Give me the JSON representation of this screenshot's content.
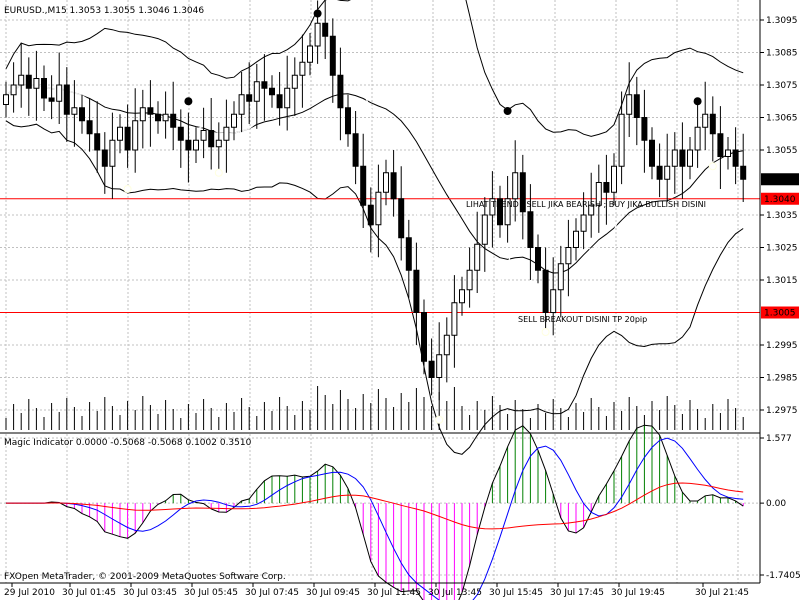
{
  "main_header": "EURUSD.,M15  1.3053 1.3055 1.3046 1.3046",
  "indicator_header": "Magic Indicator 0.0000 -0.5068 -0.5068 0.1002 0.3510",
  "copyright": "FXOpen MetaTrader, © 2001-2009 MetaQuotes Software Corp.",
  "annotations": [
    {
      "text": "LIHAT TREND : SELL JIKA BEARISH ; BUY JIKA BULLISH DISINI",
      "price": 1.3038
    },
    {
      "text": "SELL BREAKOUT DISINI TP 20pip",
      "price": 1.3003
    }
  ],
  "current_price_label": "1.3046",
  "colors": {
    "grid": "#c0c0c0",
    "bull_candle": "#ffffff",
    "bear_candle": "#000000",
    "hline": "#ff0000",
    "price_tag_bg": "#ff0000",
    "current_tag_bg": "#000000",
    "indicator_blue": "#0000ff",
    "indicator_red": "#ff0000",
    "hist_positive": "#008000",
    "hist_negative": "#ff00ff",
    "moving_average": "#ffffff"
  },
  "chart_data": [
    {
      "type": "candlestick",
      "symbol": "EURUSD.",
      "timeframe": "M15",
      "y_ticks": [
        "1.3095",
        "1.3085",
        "1.3075",
        "1.3065",
        "1.3055",
        "1.3035",
        "1.3025",
        "1.3015",
        "1.2995",
        "1.2985",
        "1.2975"
      ],
      "ylim": [
        1.2971,
        1.3102
      ],
      "horizontal_lines": [
        {
          "value": 1.304,
          "label": "1.3040"
        },
        {
          "value": 1.3005,
          "label": "1.3005"
        }
      ],
      "x_ticks": [
        "29 Jul 2010",
        "30 Jul 01:45",
        "30 Jul 03:45",
        "30 Jul 05:45",
        "30 Jul 07:45",
        "30 Jul 09:45",
        "30 Jul 11:45",
        "30 Jul 13:45",
        "30 Jul 15:45",
        "30 Jul 17:45",
        "30 Jul 19:45",
        "30 Jul 21:45"
      ],
      "closes": [
        1.3072,
        1.3075,
        1.3078,
        1.3074,
        1.3077,
        1.3071,
        1.307,
        1.3075,
        1.3066,
        1.3068,
        1.3064,
        1.306,
        1.3055,
        1.305,
        1.3058,
        1.3062,
        1.3055,
        1.3064,
        1.3068,
        1.3066,
        1.3064,
        1.3066,
        1.3062,
        1.3058,
        1.3055,
        1.3058,
        1.3061,
        1.3056,
        1.3058,
        1.3062,
        1.3066,
        1.3072,
        1.307,
        1.3076,
        1.3074,
        1.3072,
        1.3068,
        1.3074,
        1.3078,
        1.3082,
        1.3087,
        1.3094,
        1.309,
        1.3078,
        1.3068,
        1.306,
        1.305,
        1.3038,
        1.3032,
        1.3042,
        1.3048,
        1.304,
        1.3028,
        1.3018,
        1.3005,
        1.299,
        1.2985,
        1.2992,
        1.2998,
        1.3008,
        1.3012,
        1.3018,
        1.3026,
        1.3035,
        1.304,
        1.3032,
        1.304,
        1.3048,
        1.3036,
        1.3025,
        1.3018,
        1.3005,
        1.3012,
        1.302,
        1.3025,
        1.303,
        1.3035,
        1.3038,
        1.3045,
        1.3042,
        1.305,
        1.3066,
        1.3072,
        1.3065,
        1.3058,
        1.305,
        1.3046,
        1.305,
        1.3055,
        1.305,
        1.3055,
        1.3062,
        1.3066,
        1.306,
        1.3053,
        1.3055,
        1.305,
        1.3046
      ]
    },
    {
      "type": "line",
      "name": "Magic Indicator",
      "y_ticks": [
        "1.577",
        "0.00",
        "-1.7405"
      ],
      "ylim": [
        -1.7405,
        1.577
      ]
    }
  ]
}
